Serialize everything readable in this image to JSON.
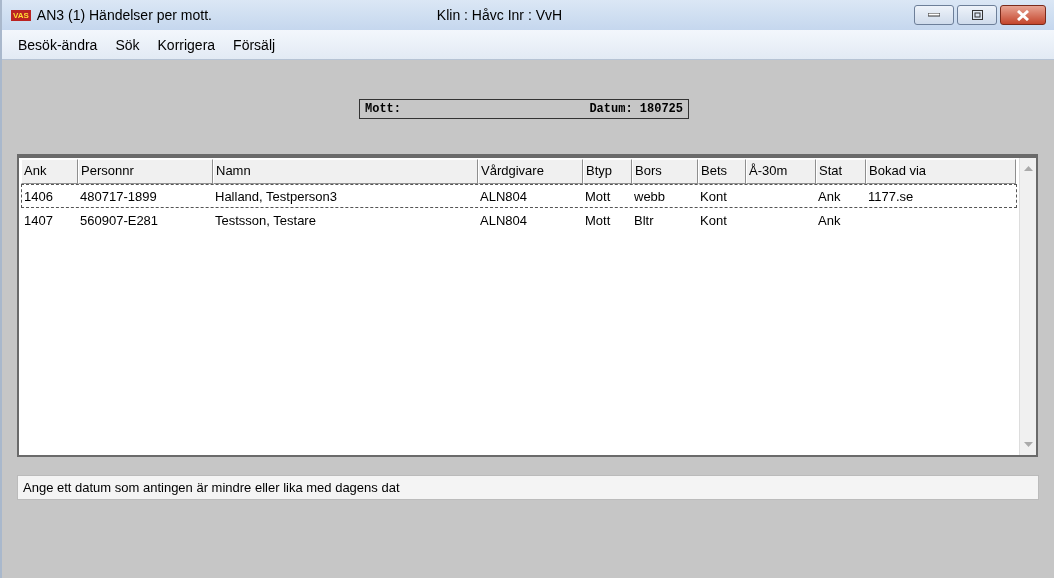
{
  "window": {
    "logo": "VAS",
    "title": "AN3 (1) Händelser per mott.",
    "context": "Klin : Håvc  Inr : VvH"
  },
  "menu": [
    "Besök-ändra",
    "Sök",
    "Korrigera",
    "Försälj"
  ],
  "header_box": {
    "label": "Mott:",
    "date": "Datum: 180725"
  },
  "table": {
    "columns": [
      "Ank",
      "Personnr",
      "Namn",
      "Vårdgivare",
      "Btyp",
      "Bors",
      "Bets",
      "Å-30m",
      "Stat",
      "Bokad via"
    ],
    "rows": [
      {
        "selected": true,
        "cells": [
          "1406",
          "480717-1899",
          "Halland, Testperson3",
          "ALN804",
          "Mott",
          "webb",
          "Kont",
          "",
          "Ank",
          "1177.se"
        ]
      },
      {
        "selected": false,
        "cells": [
          "1407",
          "560907-E281",
          "Testsson, Testare",
          "ALN804",
          "Mott",
          "Bltr",
          "Kont",
          "",
          "Ank",
          ""
        ]
      }
    ]
  },
  "status_bar": {
    "message": "Ange ett datum som antingen är mindre eller lika med dagens dat"
  }
}
